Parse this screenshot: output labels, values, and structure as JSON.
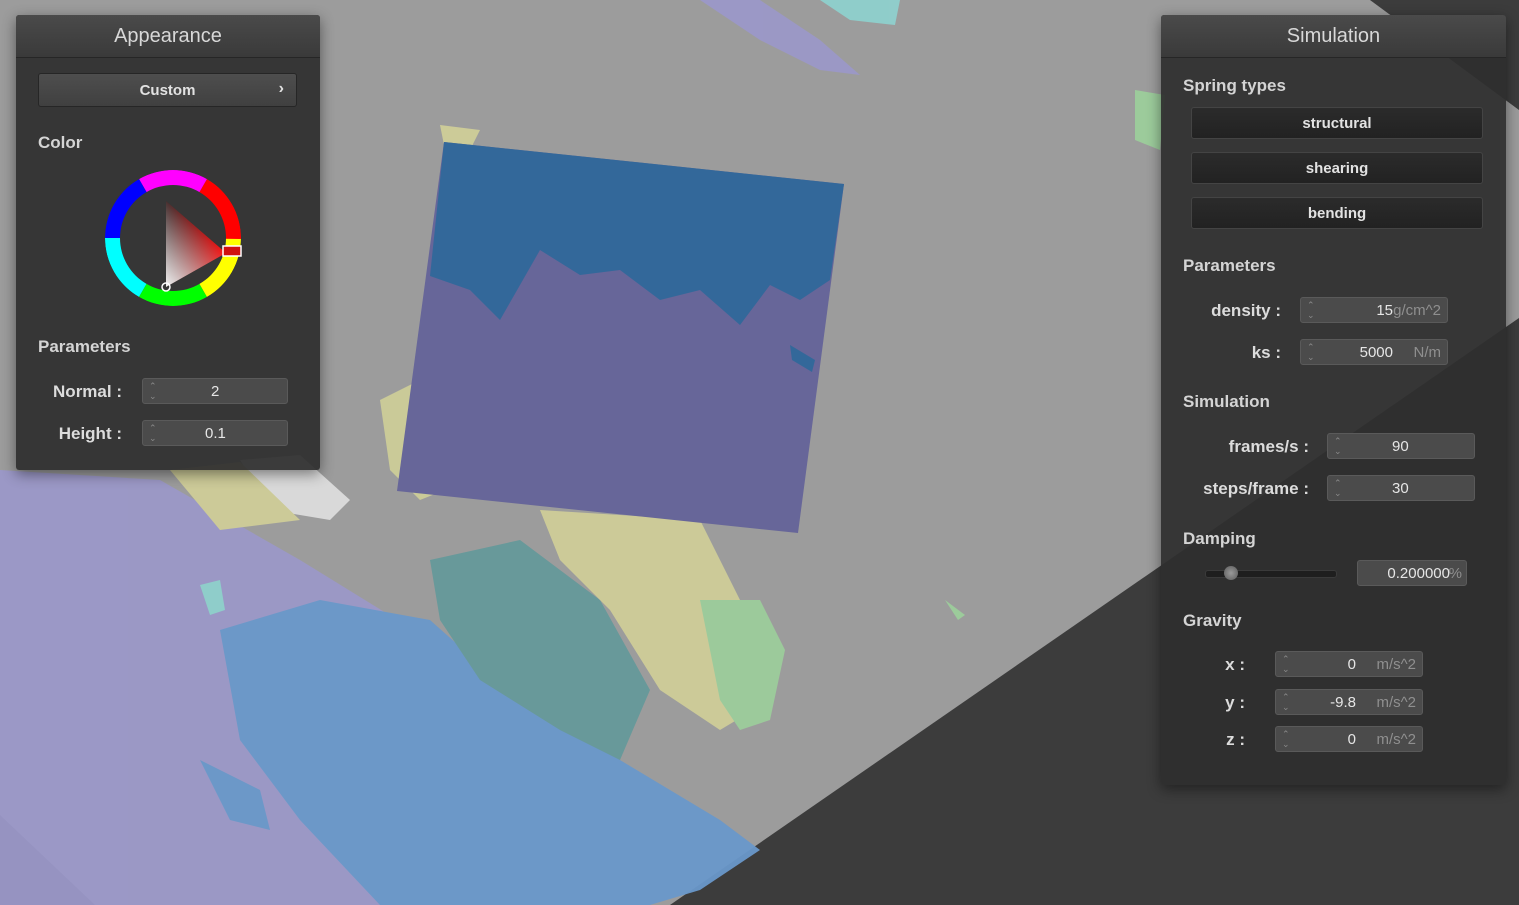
{
  "appearance": {
    "title": "Appearance",
    "preset_button": "Custom",
    "preset_chevron": "›",
    "color_label": "Color",
    "parameters_label": "Parameters",
    "normal": {
      "label": "Normal :",
      "value": "2"
    },
    "height": {
      "label": "Height :",
      "value": "0.1"
    },
    "selected_color": "#ff0000"
  },
  "simulation": {
    "title": "Simulation",
    "spring_types_label": "Spring types",
    "springs": [
      "structural",
      "shearing",
      "bending"
    ],
    "parameters_label": "Parameters",
    "density": {
      "label": "density :",
      "value": "15",
      "unit": "g/cm^2"
    },
    "ks": {
      "label": "ks :",
      "value": "5000",
      "unit": "N/m"
    },
    "simulation_label": "Simulation",
    "fps": {
      "label": "frames/s :",
      "value": "90"
    },
    "steps": {
      "label": "steps/frame :",
      "value": "30"
    },
    "damping_label": "Damping",
    "damping": {
      "value": "0.200000",
      "unit": "%",
      "slider_fraction": 0.2
    },
    "gravity_label": "Gravity",
    "gravity": [
      {
        "label": "x :",
        "value": "0",
        "unit": "m/s^2"
      },
      {
        "label": "y :",
        "value": "-9.8",
        "unit": "m/s^2"
      },
      {
        "label": "z :",
        "value": "0",
        "unit": "m/s^2"
      }
    ]
  },
  "icons": {
    "spinner": "spinner-arrows-icon",
    "chevron": "chevron-right-icon"
  },
  "colors": {
    "background": "#3c3c3c",
    "ground": "#9c9c9c",
    "cloth": "#676699",
    "cloth_top": "#33689a",
    "panel": "#2e2e2e"
  }
}
